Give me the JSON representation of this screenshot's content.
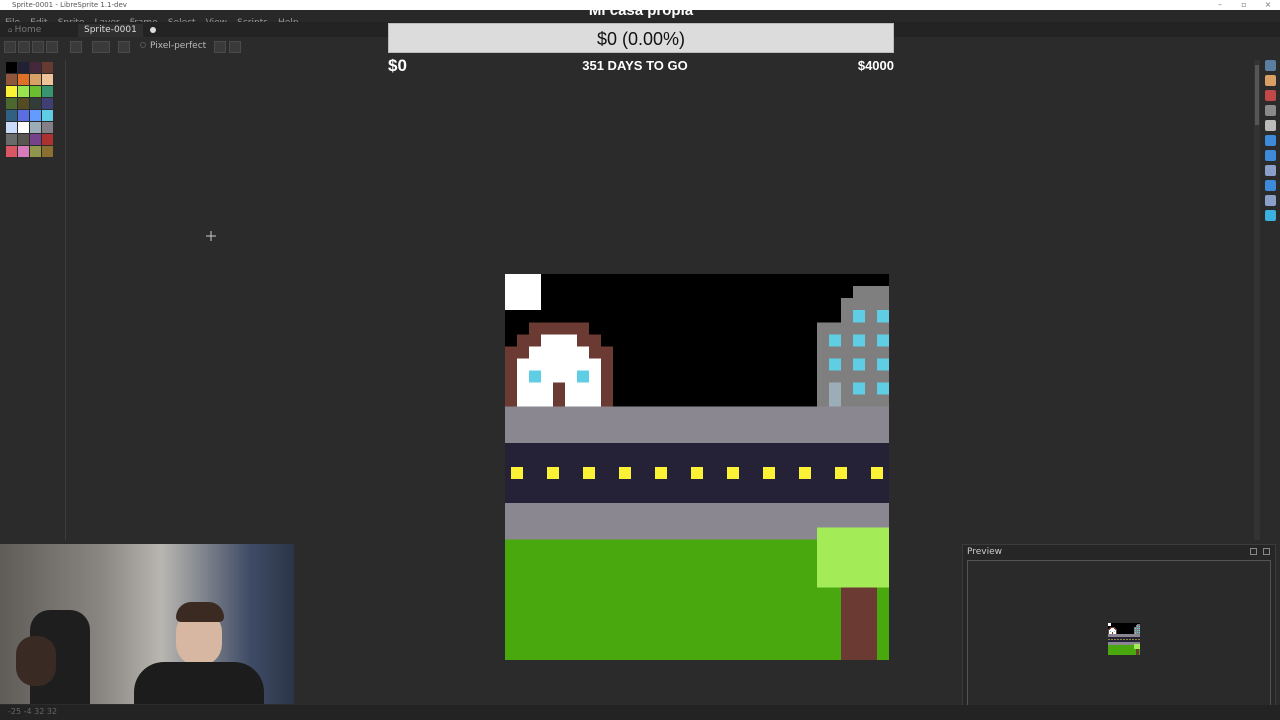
{
  "window": {
    "title": "Sprite-0001 - LibreSprite 1.1-dev",
    "buttons": [
      "–",
      "▫",
      "×"
    ]
  },
  "menu": [
    "File",
    "Edit",
    "Sprite",
    "Layer",
    "Frame",
    "Select",
    "View",
    "Scripts",
    "Help"
  ],
  "tabs": {
    "home": "Home",
    "doc": "Sprite-0001"
  },
  "tool_options": {
    "pixel_perfect": "Pixel-perfect"
  },
  "overlay": {
    "title": "Mi casa propia",
    "progress_text": "$0 (0.00%)",
    "progress_fraction": 0.0,
    "min_label": "$0",
    "days_label": "351 DAYS TO GO",
    "max_label": "$4000"
  },
  "preview": {
    "title": "Preview"
  },
  "status": {
    "text": "-25 -4  32 32"
  },
  "palette_colors": [
    "#000000",
    "#222034",
    "#45283c",
    "#663931",
    "#8f563b",
    "#df7126",
    "#d9a066",
    "#eec39a",
    "#fbf236",
    "#99e550",
    "#6abe30",
    "#37946e",
    "#4b692f",
    "#524b24",
    "#323c39",
    "#3f3f74",
    "#306082",
    "#5b6ee1",
    "#639bff",
    "#5fcde4",
    "#cbdbfc",
    "#ffffff",
    "#9badb7",
    "#847e87",
    "#696a6a",
    "#595652",
    "#76428a",
    "#ac3232",
    "#d95763",
    "#d77bba",
    "#8f974a",
    "#8a6f30"
  ],
  "sprite_colors": {
    "sky": "#000000",
    "moon": "#ffffff",
    "house_roof": "#6b3a32",
    "house_wall": "#ffffff",
    "window": "#5fcde4",
    "door": "#6b3a32",
    "building": "#7f7f7f",
    "sidewalk": "#8b8790",
    "road": "#252238",
    "road_light": "#fbf236",
    "grass": "#4aa80f",
    "tree_top": "#a3ec58",
    "tree_trunk": "#6b3a32"
  }
}
